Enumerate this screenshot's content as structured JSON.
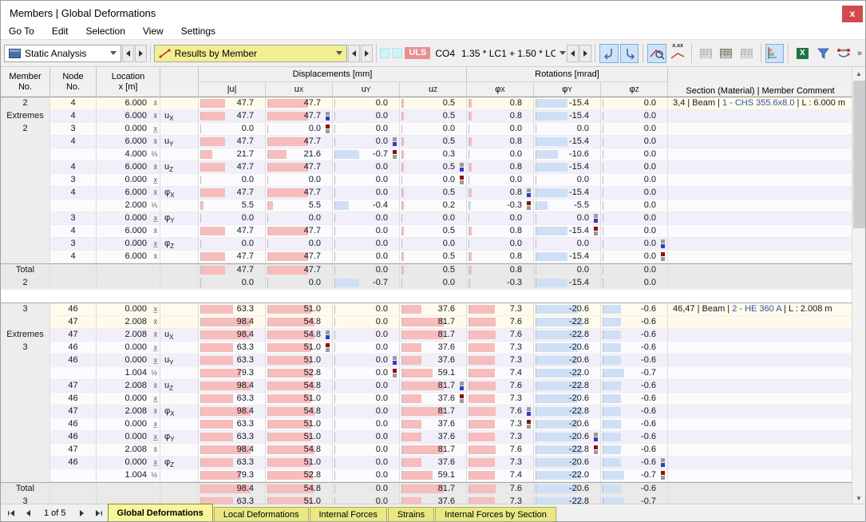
{
  "window": {
    "title": "Members | Global Deformations",
    "close_glyph": "x"
  },
  "menu": {
    "items": [
      "Go To",
      "Edit",
      "Selection",
      "View",
      "Settings"
    ]
  },
  "toolbar": {
    "analysis_combo": "Static Analysis",
    "results_combo": "Results by Member",
    "uls_badge": "ULS",
    "combination": "CO4",
    "load_combo": "1.35 * LC1 + 1.50 * LC...",
    "xxx_icon_label": "x.xx",
    "excel_icon_label": "X",
    "overflow_glyph": "»"
  },
  "table": {
    "header": {
      "member_no": [
        "Member",
        "No."
      ],
      "node_no": [
        "Node",
        "No."
      ],
      "location": [
        "Location",
        "x [m]"
      ],
      "displacements_group": "Displacements [mm]",
      "rotations_group": "Rotations [mrad]",
      "columns": [
        {
          "base": "|u|",
          "sub": ""
        },
        {
          "base": "u",
          "sub": "X"
        },
        {
          "base": "u",
          "sub": "Y"
        },
        {
          "base": "u",
          "sub": "Z"
        },
        {
          "base": "φ",
          "sub": "X"
        },
        {
          "base": "φ",
          "sub": "Y"
        },
        {
          "base": "φ",
          "sub": "Z"
        }
      ],
      "section": "Section (Material) | Member Comment"
    },
    "blocks": [
      {
        "rows": [
          {
            "member": "2",
            "node": "4",
            "loc": "6.000",
            "sym": "x̄",
            "comp": null,
            "v": [
              "47.7",
              "47.7",
              "0.0",
              "0.5",
              "0.8",
              "-15.4",
              "0.0"
            ],
            "mk": null,
            "bg": "first",
            "comment": [
              "3,4 | Beam | ",
              "1 - CHS 355.6x8.0",
              " | L : 6.000 m"
            ]
          },
          {
            "member": "Extremes",
            "node": "4",
            "loc": "6.000",
            "sym": "x̄",
            "comp": [
              "u",
              "X"
            ],
            "v": [
              "47.7",
              "47.7",
              "0.0",
              "0.5",
              "0.8",
              "-15.4",
              "0.0"
            ],
            "mk": [
              1,
              "max"
            ],
            "bg": "a"
          },
          {
            "member": "2",
            "node": "3",
            "loc": "0.000",
            "sym": "x̲",
            "comp": null,
            "v": [
              "0.0",
              "0.0",
              "0.0",
              "0.0",
              "0.0",
              "0.0",
              "0.0"
            ],
            "mk": [
              1,
              "min"
            ],
            "bg": "b"
          },
          {
            "member": "",
            "node": "4",
            "loc": "6.000",
            "sym": "x̄",
            "comp": [
              "u",
              "Y"
            ],
            "v": [
              "47.7",
              "47.7",
              "0.0",
              "0.5",
              "0.8",
              "-15.4",
              "0.0"
            ],
            "mk": [
              2,
              "max"
            ],
            "bg": "a"
          },
          {
            "member": "",
            "node": "",
            "loc": "4.000",
            "sym": "⅔",
            "comp": null,
            "v": [
              "21.7",
              "21.6",
              "-0.7",
              "0.3",
              "0.0",
              "-10.6",
              "0.0"
            ],
            "mk": [
              2,
              "min"
            ],
            "bg": "b"
          },
          {
            "member": "",
            "node": "4",
            "loc": "6.000",
            "sym": "x̄",
            "comp": [
              "u",
              "Z"
            ],
            "v": [
              "47.7",
              "47.7",
              "0.0",
              "0.5",
              "0.8",
              "-15.4",
              "0.0"
            ],
            "mk": [
              3,
              "max"
            ],
            "bg": "a"
          },
          {
            "member": "",
            "node": "3",
            "loc": "0.000",
            "sym": "x̲",
            "comp": null,
            "v": [
              "0.0",
              "0.0",
              "0.0",
              "0.0",
              "0.0",
              "0.0",
              "0.0"
            ],
            "mk": [
              3,
              "min"
            ],
            "bg": "b"
          },
          {
            "member": "",
            "node": "4",
            "loc": "6.000",
            "sym": "x̄",
            "comp": [
              "φ",
              "X"
            ],
            "v": [
              "47.7",
              "47.7",
              "0.0",
              "0.5",
              "0.8",
              "-15.4",
              "0.0"
            ],
            "mk": [
              4,
              "max"
            ],
            "bg": "a"
          },
          {
            "member": "",
            "node": "",
            "loc": "2.000",
            "sym": "⅓",
            "comp": null,
            "v": [
              "5.5",
              "5.5",
              "-0.4",
              "0.2",
              "-0.3",
              "-5.5",
              "0.0"
            ],
            "mk": [
              4,
              "min"
            ],
            "bg": "b"
          },
          {
            "member": "",
            "node": "3",
            "loc": "0.000",
            "sym": "x̲",
            "comp": [
              "φ",
              "Y"
            ],
            "v": [
              "0.0",
              "0.0",
              "0.0",
              "0.0",
              "0.0",
              "0.0",
              "0.0"
            ],
            "mk": [
              5,
              "max"
            ],
            "bg": "a"
          },
          {
            "member": "",
            "node": "4",
            "loc": "6.000",
            "sym": "x̄",
            "comp": null,
            "v": [
              "47.7",
              "47.7",
              "0.0",
              "0.5",
              "0.8",
              "-15.4",
              "0.0"
            ],
            "mk": [
              5,
              "min"
            ],
            "bg": "b"
          },
          {
            "member": "",
            "node": "3",
            "loc": "0.000",
            "sym": "x̲",
            "comp": [
              "φ",
              "Z"
            ],
            "v": [
              "0.0",
              "0.0",
              "0.0",
              "0.0",
              "0.0",
              "0.0",
              "0.0"
            ],
            "mk": [
              6,
              "max"
            ],
            "bg": "a"
          },
          {
            "member": "",
            "node": "4",
            "loc": "6.000",
            "sym": "x̄",
            "comp": null,
            "v": [
              "47.7",
              "47.7",
              "0.0",
              "0.5",
              "0.8",
              "-15.4",
              "0.0"
            ],
            "mk": [
              6,
              "min"
            ],
            "bg": "b"
          },
          {
            "member": "Total",
            "node": "",
            "loc": "",
            "sym": "",
            "comp": null,
            "v": [
              "47.7",
              "47.7",
              "0.0",
              "0.5",
              "0.8",
              "0.0",
              "0.0"
            ],
            "mk": null,
            "bg": "total",
            "top": true
          },
          {
            "member": "2",
            "node": "",
            "loc": "",
            "sym": "",
            "comp": null,
            "v": [
              "0.0",
              "0.0",
              "-0.7",
              "0.0",
              "-0.3",
              "-15.4",
              "0.0"
            ],
            "mk": null,
            "bg": "total"
          }
        ]
      },
      {
        "rows": [
          {
            "member": "3",
            "node": "46",
            "loc": "0.000",
            "sym": "x̲",
            "comp": null,
            "v": [
              "63.3",
              "51.0",
              "0.0",
              "37.6",
              "7.3",
              "-20.6",
              "-0.6"
            ],
            "mk": null,
            "bg": "first",
            "top": true,
            "comment": [
              "46,47 | Beam | ",
              "2 - HE 360 A",
              " | L : 2.008 m"
            ]
          },
          {
            "member": "",
            "node": "47",
            "loc": "2.008",
            "sym": "x̄",
            "comp": null,
            "v": [
              "98.4",
              "54.8",
              "0.0",
              "81.7",
              "7.6",
              "-22.8",
              "-0.6"
            ],
            "mk": null,
            "bg": "first"
          },
          {
            "member": "Extremes",
            "node": "47",
            "loc": "2.008",
            "sym": "x̄",
            "comp": [
              "u",
              "X"
            ],
            "v": [
              "98.4",
              "54.8",
              "0.0",
              "81.7",
              "7.6",
              "-22.8",
              "-0.6"
            ],
            "mk": [
              1,
              "max"
            ],
            "bg": "a"
          },
          {
            "member": "3",
            "node": "46",
            "loc": "0.000",
            "sym": "x̲",
            "comp": null,
            "v": [
              "63.3",
              "51.0",
              "0.0",
              "37.6",
              "7.3",
              "-20.6",
              "-0.6"
            ],
            "mk": [
              1,
              "min"
            ],
            "bg": "b"
          },
          {
            "member": "",
            "node": "46",
            "loc": "0.000",
            "sym": "x̲",
            "comp": [
              "u",
              "Y"
            ],
            "v": [
              "63.3",
              "51.0",
              "0.0",
              "37.6",
              "7.3",
              "-20.6",
              "-0.6"
            ],
            "mk": [
              2,
              "max"
            ],
            "bg": "a"
          },
          {
            "member": "",
            "node": "",
            "loc": "1.004",
            "sym": "½",
            "comp": null,
            "v": [
              "79.3",
              "52.8",
              "0.0",
              "59.1",
              "7.4",
              "-22.0",
              "-0.7"
            ],
            "mk": [
              2,
              "min"
            ],
            "bg": "b"
          },
          {
            "member": "",
            "node": "47",
            "loc": "2.008",
            "sym": "x̄",
            "comp": [
              "u",
              "Z"
            ],
            "v": [
              "98.4",
              "54.8",
              "0.0",
              "81.7",
              "7.6",
              "-22.8",
              "-0.6"
            ],
            "mk": [
              3,
              "max"
            ],
            "bg": "a"
          },
          {
            "member": "",
            "node": "46",
            "loc": "0.000",
            "sym": "x̲",
            "comp": null,
            "v": [
              "63.3",
              "51.0",
              "0.0",
              "37.6",
              "7.3",
              "-20.6",
              "-0.6"
            ],
            "mk": [
              3,
              "min"
            ],
            "bg": "b"
          },
          {
            "member": "",
            "node": "47",
            "loc": "2.008",
            "sym": "x̄",
            "comp": [
              "φ",
              "X"
            ],
            "v": [
              "98.4",
              "54.8",
              "0.0",
              "81.7",
              "7.6",
              "-22.8",
              "-0.6"
            ],
            "mk": [
              4,
              "max"
            ],
            "bg": "a"
          },
          {
            "member": "",
            "node": "46",
            "loc": "0.000",
            "sym": "x̲",
            "comp": null,
            "v": [
              "63.3",
              "51.0",
              "0.0",
              "37.6",
              "7.3",
              "-20.6",
              "-0.6"
            ],
            "mk": [
              4,
              "min"
            ],
            "bg": "b"
          },
          {
            "member": "",
            "node": "46",
            "loc": "0.000",
            "sym": "x̲",
            "comp": [
              "φ",
              "Y"
            ],
            "v": [
              "63.3",
              "51.0",
              "0.0",
              "37.6",
              "7.3",
              "-20.6",
              "-0.6"
            ],
            "mk": [
              5,
              "max"
            ],
            "bg": "a"
          },
          {
            "member": "",
            "node": "47",
            "loc": "2.008",
            "sym": "x̄",
            "comp": null,
            "v": [
              "98.4",
              "54.8",
              "0.0",
              "81.7",
              "7.6",
              "-22.8",
              "-0.6"
            ],
            "mk": [
              5,
              "min"
            ],
            "bg": "b"
          },
          {
            "member": "",
            "node": "46",
            "loc": "0.000",
            "sym": "x̲",
            "comp": [
              "φ",
              "Z"
            ],
            "v": [
              "63.3",
              "51.0",
              "0.0",
              "37.6",
              "7.3",
              "-20.6",
              "-0.6"
            ],
            "mk": [
              6,
              "max"
            ],
            "bg": "a"
          },
          {
            "member": "",
            "node": "",
            "loc": "1.004",
            "sym": "½",
            "comp": null,
            "v": [
              "79.3",
              "52.8",
              "0.0",
              "59.1",
              "7.4",
              "-22.0",
              "-0.7"
            ],
            "mk": [
              6,
              "min"
            ],
            "bg": "b"
          },
          {
            "member": "Total",
            "node": "",
            "loc": "",
            "sym": "",
            "comp": null,
            "v": [
              "98.4",
              "54.8",
              "0.0",
              "81.7",
              "7.6",
              "-20.6",
              "-0.6"
            ],
            "mk": null,
            "bg": "total",
            "top": true
          },
          {
            "member": "3",
            "node": "",
            "loc": "",
            "sym": "",
            "comp": null,
            "v": [
              "63.3",
              "51.0",
              "0.0",
              "37.6",
              "7.3",
              "-22.8",
              "-0.7"
            ],
            "mk": null,
            "bg": "total"
          }
        ]
      }
    ]
  },
  "statusbar": {
    "page": "1 of 5",
    "tabs": [
      {
        "label": "Global Deformations",
        "active": true
      },
      {
        "label": "Local Deformations",
        "active": false
      },
      {
        "label": "Internal Forces",
        "active": false
      },
      {
        "label": "Strains",
        "active": false
      },
      {
        "label": "Internal Forces by Section",
        "active": false
      }
    ]
  }
}
